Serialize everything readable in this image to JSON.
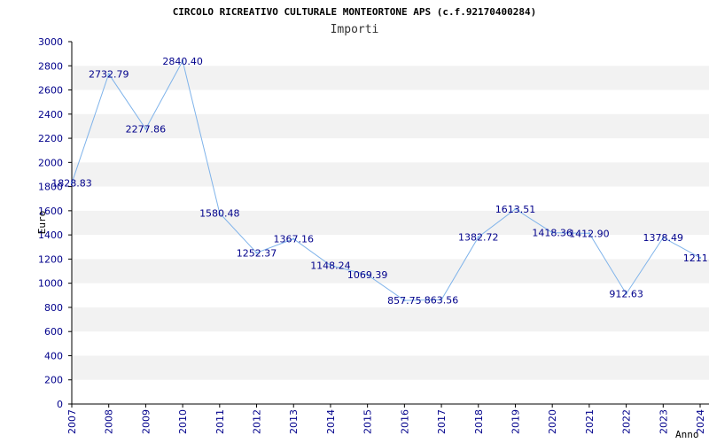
{
  "chart_data": {
    "type": "line",
    "title": "CIRCOLO RICREATIVO CULTURALE MONTEORTONE APS (c.f.92170400284)",
    "subtitle": "Importi",
    "xlabel": "Anno",
    "ylabel": "Euro",
    "x": [
      "2007",
      "2008",
      "2009",
      "2010",
      "2011",
      "2012",
      "2013",
      "2014",
      "2015",
      "2016",
      "2017",
      "2018",
      "2019",
      "2020",
      "2021",
      "2022",
      "2023",
      "2024"
    ],
    "values": [
      1828.83,
      2732.79,
      2277.86,
      2840.4,
      1580.48,
      1252.37,
      1367.16,
      1148.24,
      1069.39,
      857.75,
      863.56,
      1382.72,
      1613.51,
      1418.36,
      1412.9,
      912.63,
      1378.49,
      1211.03
    ],
    "data_labels": [
      "1828.83",
      "2732.79",
      "2277.86",
      "2840.40",
      "1580.48",
      "1252.37",
      "1367.16",
      "1148.24",
      "1069.39",
      "857.75",
      "863.56",
      "1382.72",
      "1613.51",
      "1418.36",
      "1412.90",
      "912.63",
      "1378.49",
      "1211.0"
    ],
    "ylim": [
      0,
      3000
    ],
    "yticks": [
      "0",
      "200",
      "400",
      "600",
      "800",
      "1000",
      "1200",
      "1400",
      "1600",
      "1800",
      "2000",
      "2200",
      "2400",
      "2600",
      "2800",
      "3000"
    ],
    "grid": "horizontal alternating bands",
    "colors": {
      "line": "#7fb3ea",
      "label": "#00008b",
      "title": "#000000",
      "band": "#f2f2f2",
      "axis": "#000000"
    }
  }
}
